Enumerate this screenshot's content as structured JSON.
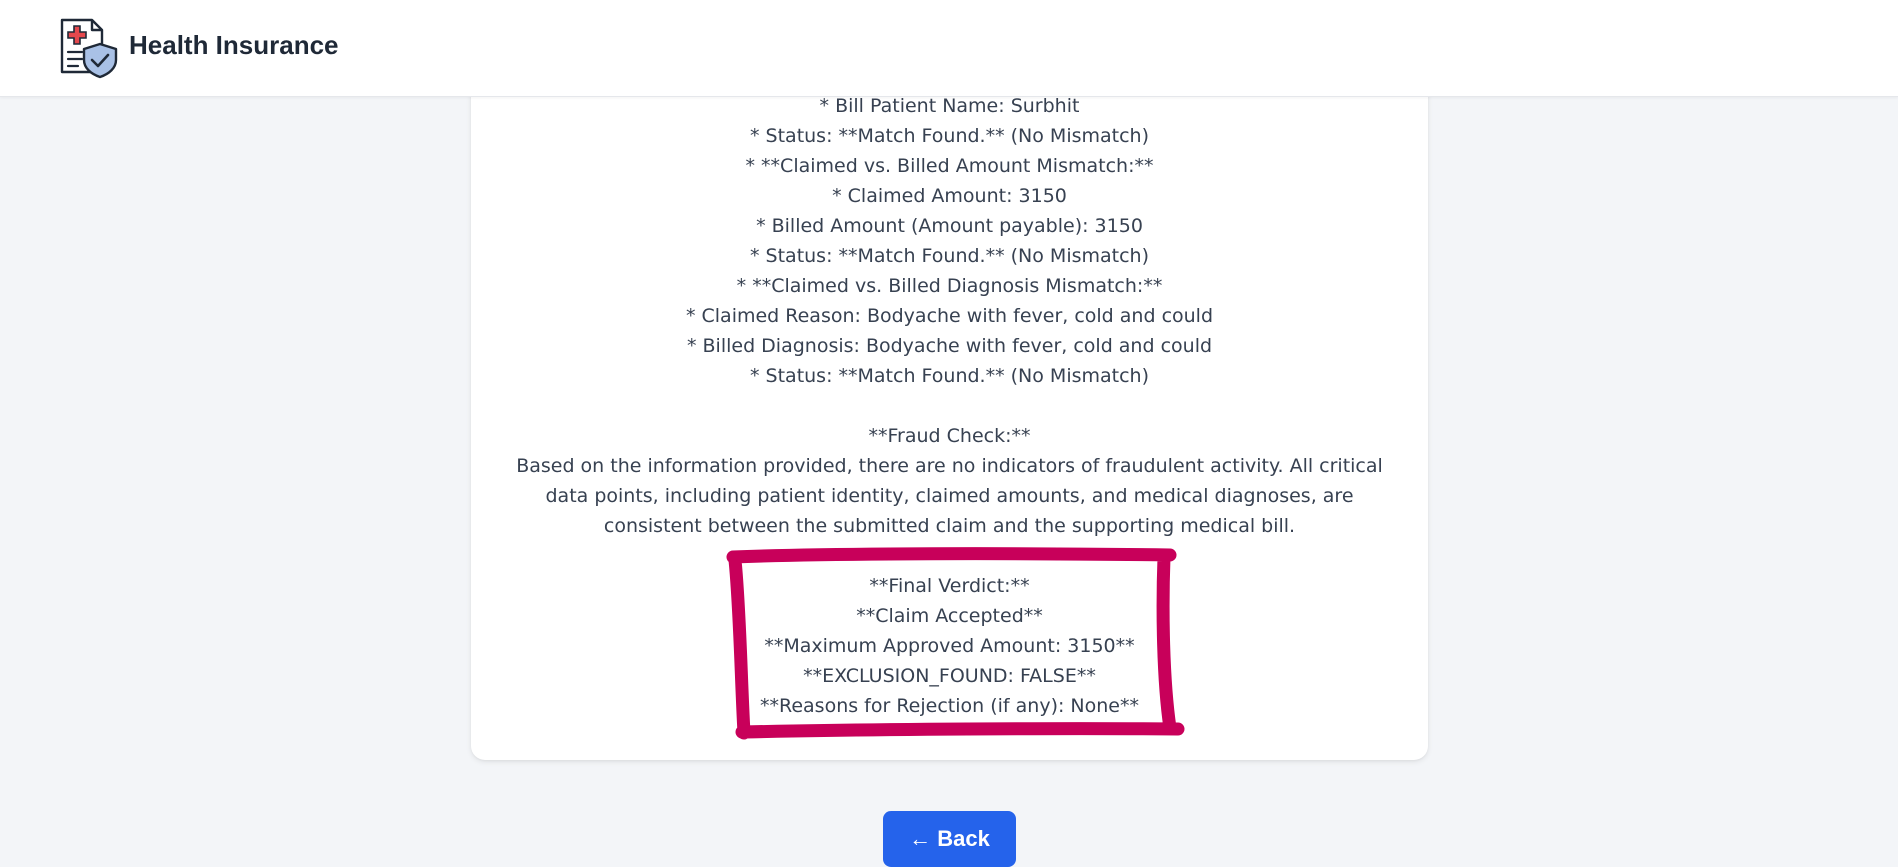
{
  "header": {
    "title": "Health Insurance",
    "logo_icon": "insurance-document-shield-icon"
  },
  "details": {
    "lines": [
      "* Bill Patient Name: Surbhit",
      "* Status: **Match Found.** (No Mismatch)",
      "* **Claimed vs. Billed Amount Mismatch:**",
      "* Claimed Amount: 3150",
      "* Billed Amount (Amount payable): 3150",
      "* Status: **Match Found.** (No Mismatch)",
      "* **Claimed vs. Billed Diagnosis Mismatch:**",
      "* Claimed Reason: Bodyache with fever, cold and could",
      "* Billed Diagnosis: Bodyache with fever, cold and could",
      "* Status: **Match Found.** (No Mismatch)"
    ]
  },
  "fraud": {
    "heading": "**Fraud Check:**",
    "text": "Based on the information provided, there are no indicators of fraudulent activity. All critical data points, including patient identity, claimed amounts, and medical diagnoses, are consistent between the submitted claim and the supporting medical bill."
  },
  "verdict": {
    "heading": "**Final Verdict:**",
    "decision": "**Claim Accepted**",
    "max_amount": "**Maximum Approved Amount: 3150**",
    "exclusion": "**EXCLUSION_FOUND: FALSE**",
    "reasons": "**Reasons for Rejection (if any): None**"
  },
  "annotation": {
    "color": "#c8005a"
  },
  "back_button": {
    "label": "← Back",
    "color": "#2563eb"
  }
}
